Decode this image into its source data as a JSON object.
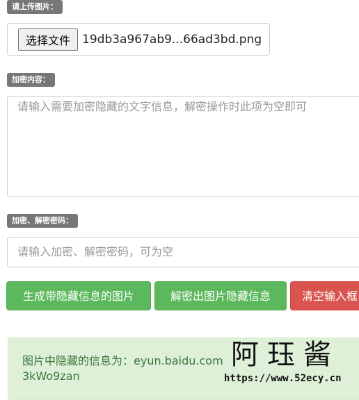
{
  "upload": {
    "label": "请上传图片：",
    "button_label": "选择文件",
    "file_name": "19db3a967ab9...66ad3bd.png"
  },
  "encrypt_content": {
    "label": "加密内容：",
    "placeholder": "请输入需要加密隐藏的文字信息，解密操作时此项为空即可"
  },
  "password": {
    "label": "加密、解密密码：",
    "placeholder": "请输入加密、解密密码，可为空"
  },
  "actions": {
    "generate": "生成带隐藏信息的图片",
    "decrypt": "解密出图片隐藏信息",
    "clear": "清空输入框"
  },
  "result": {
    "prefix": "图片中隐藏的信息为：",
    "line1_value": "eyun.baidu.com",
    "line2_value": "3kWo9zan"
  },
  "watermark": {
    "title": "阿珏酱",
    "url": "https://www.52ecy.cn"
  },
  "colors": {
    "badge": "#777777",
    "success": "#5cb85c",
    "danger": "#d9534f",
    "result_bg": "#dff0d8",
    "result_text": "#3c763d"
  }
}
